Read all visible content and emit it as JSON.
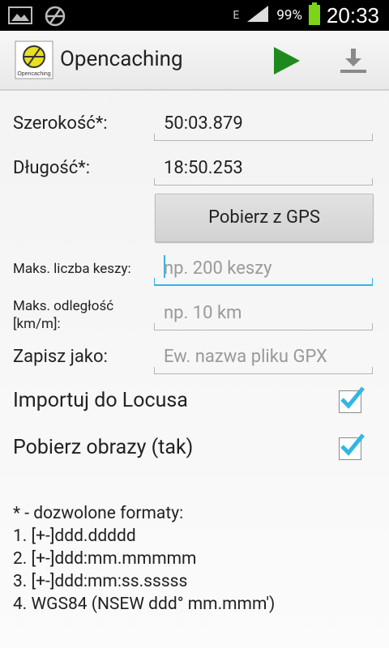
{
  "status_bar": {
    "time": "20:33",
    "battery_percent": "99%",
    "network_type": "E",
    "icons": [
      "image-icon",
      "geocaching-icon",
      "signal-icon",
      "battery-icon"
    ]
  },
  "action_bar": {
    "title": "Opencaching",
    "icon": "opencaching-logo",
    "actions": [
      "play-icon",
      "download-icon"
    ]
  },
  "form": {
    "latitude": {
      "label": "Szerokość*:",
      "value": "50:03.879"
    },
    "longitude": {
      "label": "Długość*:",
      "value": "18:50.253"
    },
    "gps_button": "Pobierz z GPS",
    "max_caches": {
      "label": "Maks. liczba keszy:",
      "placeholder": "np. 200 keszy"
    },
    "max_distance": {
      "label_line1": "Maks. odległość",
      "label_line2": "[km/m]:",
      "placeholder": "np. 10 km"
    },
    "save_as": {
      "label": "Zapisz jako:",
      "placeholder": "Ew. nazwa pliku GPX"
    },
    "import_locus": {
      "label": "Importuj do Locusa",
      "checked": true
    },
    "download_images": {
      "label": "Pobierz obrazy (tak)",
      "checked": true
    }
  },
  "notes": {
    "header": "* - dozwolone formaty:",
    "lines": [
      "1. [+-]ddd.ddddd",
      "2. [+-]ddd:mm.mmmmm",
      "3. [+-]ddd:mm:ss.sssss",
      "4. WGS84 (NSEW ddd° mm.mmm')"
    ]
  },
  "colors": {
    "accent": "#33b5e5",
    "play_green": "#1e8a1e",
    "checkmark": "#33b5e5"
  }
}
